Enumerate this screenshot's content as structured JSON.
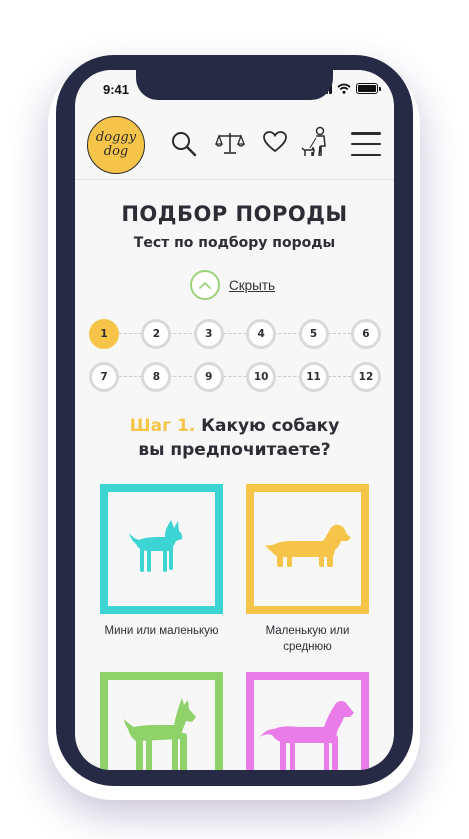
{
  "status": {
    "time": "9:41"
  },
  "logo": {
    "line1": "doggy",
    "line2": "dog"
  },
  "header": {
    "icons": [
      "search-icon",
      "scales-icon",
      "heart-icon",
      "dog-walker-icon",
      "menu-icon"
    ]
  },
  "page": {
    "title": "ПОДБОР ПОРОДЫ",
    "subtitle": "Тест по подбору породы",
    "toggle_label": "Скрыть"
  },
  "steps": {
    "row1": [
      "1",
      "2",
      "3",
      "4",
      "5",
      "6"
    ],
    "row2": [
      "7",
      "8",
      "9",
      "10",
      "11",
      "12"
    ],
    "active": "1"
  },
  "question": {
    "step_label": "Шаг 1.",
    "text_line1": "Какую собаку",
    "text_line2": "вы предпочитаете?"
  },
  "options": [
    {
      "label": "Мини или маленькую",
      "color": "#3dd4d4",
      "icon": "chihuahua-icon"
    },
    {
      "label": "Маленькую или среднюю",
      "color": "#f6c449",
      "icon": "dachshund-icon"
    },
    {
      "label": "",
      "color": "#8fd26a",
      "icon": "boxer-icon"
    },
    {
      "label": "",
      "color": "#e97ce8",
      "icon": "great-dane-icon"
    }
  ],
  "colors": {
    "accent": "#f6c449",
    "text": "#2d2d35",
    "phone": "#262a44",
    "toggle": "#9cd37b"
  }
}
